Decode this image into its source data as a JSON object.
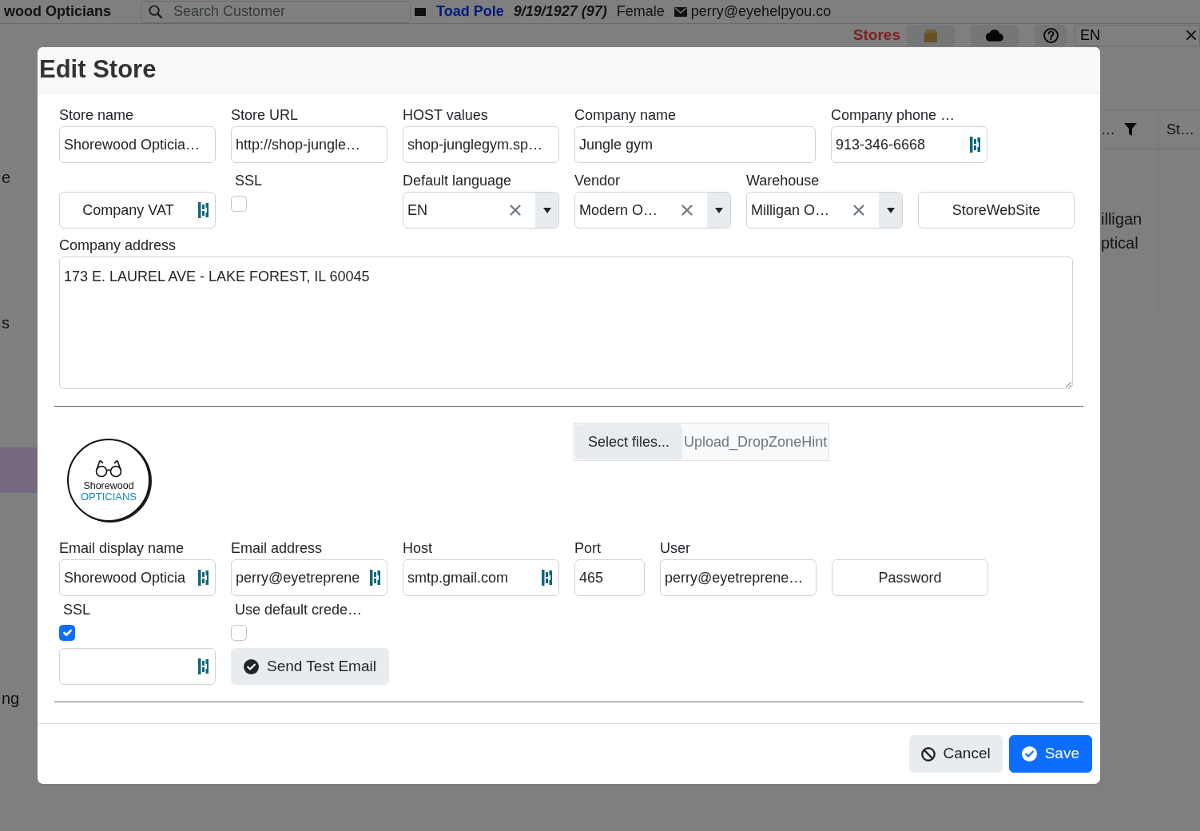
{
  "page": {
    "brand": "wood Opticians",
    "search": {
      "placeholder": "Search Customer"
    },
    "patient": {
      "name": "Toad Pole",
      "birth_date": "9/19/1927 (97)",
      "gender": "Female",
      "email": "perry@eyehelpyou.co"
    },
    "toolbar": {
      "title": "Stores",
      "language": "EN"
    },
    "sidebar": {
      "items": [
        {
          "label": "e",
          "selected": false
        },
        {
          "label": "s",
          "selected": false
        },
        {
          "selected": true
        },
        {
          "label": "ng",
          "selected": false
        }
      ]
    },
    "table": {
      "columns": [
        "…",
        "St…"
      ],
      "rows": [
        [
          "illigan ptical"
        ]
      ]
    }
  },
  "dialog": {
    "title": "Edit Store",
    "store_rows": [
      [
        {
          "kind": "text",
          "label": "Store name",
          "value": "Shorewood Opticia…",
          "autofill_icon": false
        },
        {
          "kind": "text",
          "label": "Store URL",
          "value": "http://shop-jungle…",
          "autofill_icon": false
        },
        {
          "kind": "text",
          "label": "HOST values",
          "value": "shop-junglegym.sp…",
          "autofill_icon": false
        },
        {
          "kind": "text",
          "label": "Company name",
          "value": "Jungle gym",
          "autofill_icon": false
        },
        {
          "kind": "text",
          "label": "Company phone …",
          "value": "913-346-6668",
          "autofill_icon": true
        }
      ],
      [
        {
          "kind": "text",
          "placeholder": "Company VAT",
          "autofill_icon": true
        },
        {
          "kind": "checkbox",
          "label": "SSL",
          "checked": false
        },
        {
          "kind": "combo",
          "label": "Default language",
          "value": "EN"
        },
        {
          "kind": "combo",
          "label": "Vendor",
          "value": "Modern O…"
        },
        {
          "kind": "combo",
          "label": "Warehouse",
          "value": "Milligan O…"
        },
        {
          "kind": "text",
          "placeholder": "StoreWebSite",
          "autofill_icon": false
        }
      ],
      [
        {
          "kind": "textarea",
          "label": "Company address",
          "value": "173 E. LAUREL AVE - LAKE FOREST, IL 60045"
        }
      ]
    ],
    "logo": {
      "name": "Shorewood",
      "tagline": "OPTICIANS"
    },
    "upload": {
      "button": "Select files...",
      "hint": "Upload_DropZoneHint"
    },
    "email_rows": [
      [
        {
          "kind": "text",
          "label": "Email display name",
          "value": "Shorewood Opticia",
          "autofill_icon": true
        },
        {
          "kind": "text",
          "label": "Email address",
          "value": "perry@eyetreprene",
          "autofill_icon": true
        },
        {
          "kind": "text",
          "label": "Host",
          "value": "smtp.gmail.com",
          "autofill_icon": true
        },
        {
          "kind": "text",
          "label": "Port",
          "value": "465",
          "autofill_icon": false
        },
        {
          "kind": "text",
          "label": "User",
          "value": "perry@eyetreprene…",
          "autofill_icon": false
        },
        {
          "kind": "text",
          "placeholder": "Password",
          "autofill_icon": false
        }
      ],
      [
        {
          "kind": "checkbox",
          "label": "SSL",
          "checked": true
        },
        {
          "kind": "checkbox",
          "label": "Use default crede…",
          "checked": false
        }
      ],
      [
        {
          "kind": "text",
          "autofill_icon": true
        },
        {
          "kind": "button",
          "label": "Send Test Email"
        }
      ]
    ],
    "buttons": [
      {
        "kind": "cancel",
        "label": "Cancel"
      },
      {
        "kind": "save",
        "label": "Save"
      }
    ]
  }
}
